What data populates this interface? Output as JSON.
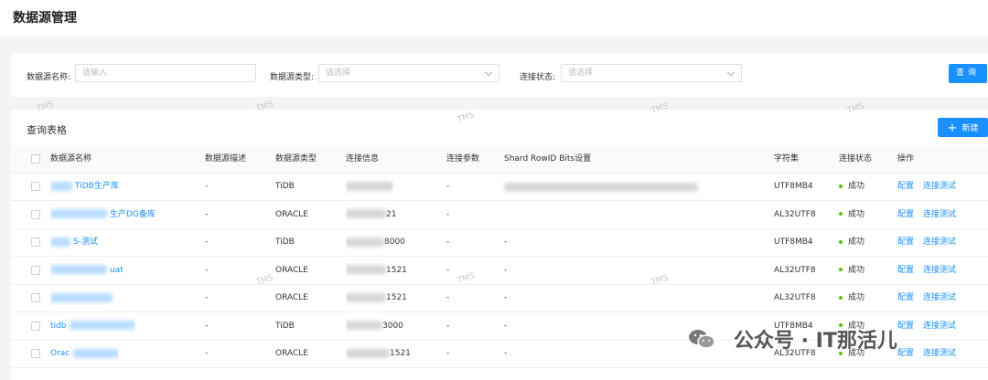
{
  "page_title": "数据源管理",
  "search": {
    "name_label": "数据源名称:",
    "name_placeholder": "请输入",
    "type_label": "数据源类型:",
    "type_placeholder": "请选择",
    "status_label": "连接状态:",
    "status_placeholder": "请选择",
    "query_button": "查询"
  },
  "table": {
    "title": "查询表格",
    "new_button": "新建",
    "columns": [
      "数据源名称",
      "数据源描述",
      "数据源类型",
      "连接信息",
      "连接参数",
      "Shard RowID Bits设置",
      "字符集",
      "连接状态",
      "操作"
    ],
    "rows": [
      {
        "name": "TiDB生产库",
        "desc": "-",
        "type": "TiDB",
        "conn_suffix": "",
        "params": "-",
        "shard": "",
        "charset": "UTF8MB4",
        "status": "成功",
        "action_config": "配置",
        "action_test": "连接测试"
      },
      {
        "name": "生产DG备库",
        "desc": "-",
        "type": "ORACLE",
        "conn_suffix": "21",
        "params": "-",
        "shard": "",
        "charset": "AL32UTF8",
        "status": "成功",
        "action_config": "配置",
        "action_test": "连接测试"
      },
      {
        "name": "S-测试",
        "desc": "-",
        "type": "TiDB",
        "conn_suffix": "8000",
        "params": "-",
        "shard": "-",
        "charset": "UTF8MB4",
        "status": "成功",
        "action_config": "配置",
        "action_test": "连接测试"
      },
      {
        "name": "uat",
        "desc": "-",
        "type": "ORACLE",
        "conn_suffix": "1521",
        "params": "-",
        "shard": "-",
        "charset": "AL32UTF8",
        "status": "成功",
        "action_config": "配置",
        "action_test": "连接测试"
      },
      {
        "name": "",
        "desc": "-",
        "type": "ORACLE",
        "conn_suffix": "1521",
        "params": "-",
        "shard": "-",
        "charset": "AL32UTF8",
        "status": "成功",
        "action_config": "配置",
        "action_test": "连接测试"
      },
      {
        "name": "tidb",
        "desc": "-",
        "type": "TiDB",
        "conn_suffix": "3000",
        "params": "-",
        "shard": "-",
        "charset": "UTF8MB4",
        "status": "成功",
        "action_config": "配置",
        "action_test": "连接测试"
      },
      {
        "name": "Orac",
        "desc": "-",
        "type": "ORACLE",
        "conn_suffix": "1521",
        "params": "-",
        "shard": "-",
        "charset": "AL32UTF8",
        "status": "成功",
        "action_config": "配置",
        "action_test": "连接测试"
      }
    ]
  },
  "watermark": "TMS",
  "overlay": {
    "text": "公众号 · IT那活儿"
  },
  "colors": {
    "primary": "#1890ff",
    "success": "#52c41a"
  }
}
